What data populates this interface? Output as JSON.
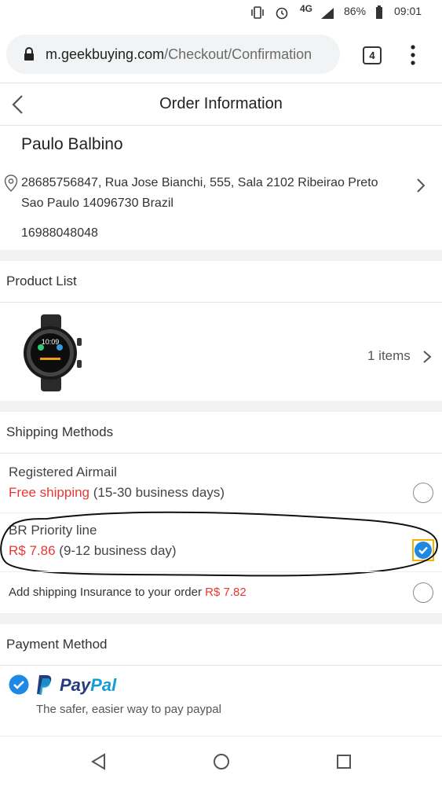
{
  "status_bar": {
    "network": "4G",
    "battery": "86%",
    "time": "09:01"
  },
  "browser": {
    "url_host": "m.geekbuying.com",
    "url_path": "/Checkout/Confirmation",
    "tab_count": "4"
  },
  "header": {
    "title": "Order Information"
  },
  "address": {
    "name": "Paulo Balbino",
    "line": "28685756847, Rua Jose Bianchi, 555, Sala 2102 Ribeirao Preto Sao Paulo 14096730 Brazil",
    "phone": "16988048048"
  },
  "product_list": {
    "title": "Product List",
    "items_count": "1 items",
    "watch_time": "10:09"
  },
  "shipping": {
    "title": "Shipping Methods",
    "options": [
      {
        "name": "Registered Airmail",
        "price": "Free shipping",
        "days": "(15-30 business days)",
        "selected": false
      },
      {
        "name": "BR Priority line",
        "price": "R$ 7.86",
        "days": "(9-12 business day)",
        "selected": true
      }
    ],
    "insurance_label": "Add shipping Insurance to your order",
    "insurance_price": "R$ 7.82"
  },
  "payment": {
    "title": "Payment Method",
    "brand_pay": "Pay",
    "brand_pal": "Pal",
    "subtitle": "The safer, easier way to pay paypal"
  },
  "colors": {
    "accent_red": "#e53935",
    "check_blue": "#1e88e5",
    "paypal_dark": "#253b80",
    "paypal_light": "#179bd7"
  }
}
